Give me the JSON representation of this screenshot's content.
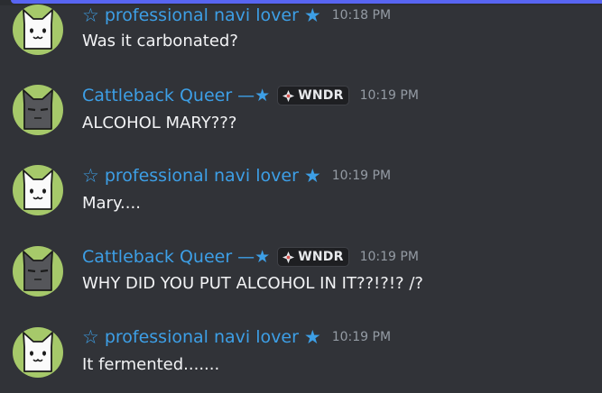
{
  "messages": [
    {
      "author": "professional navi lover",
      "author_style": "navi",
      "time": "10:18 PM",
      "text": "Was it carbonated?",
      "avatar": "white-cat-avatar"
    },
    {
      "author": "Cattleback Queer",
      "author_suffix": "—★",
      "author_style": "cattle",
      "tag": "WNDR",
      "time": "10:19 PM",
      "text": "ALCOHOL MARY???",
      "avatar": "gray-cat-avatar"
    },
    {
      "author": "professional navi lover",
      "author_style": "navi",
      "time": "10:19 PM",
      "text": "Mary....",
      "avatar": "white-cat-avatar"
    },
    {
      "author": "Cattleback Queer",
      "author_suffix": "—★",
      "author_style": "cattle",
      "tag": "WNDR",
      "time": "10:19 PM",
      "text": "WHY DID YOU PUT ALCOHOL IN IT??!?!? /?",
      "avatar": "gray-cat-avatar"
    },
    {
      "author": "professional navi lover",
      "author_style": "navi",
      "time": "10:19 PM",
      "text": "It fermented.......",
      "avatar": "white-cat-avatar"
    }
  ],
  "colors": {
    "background": "#313338",
    "username": "#3d9fe6",
    "timestamp": "#949ba4",
    "message_text": "#f2f3f5",
    "avatar_bg": "#a6c96a"
  },
  "icons": {
    "hollow_star": "☆",
    "solid_star": "★",
    "tag_icon": "compass-diamond-icon"
  }
}
